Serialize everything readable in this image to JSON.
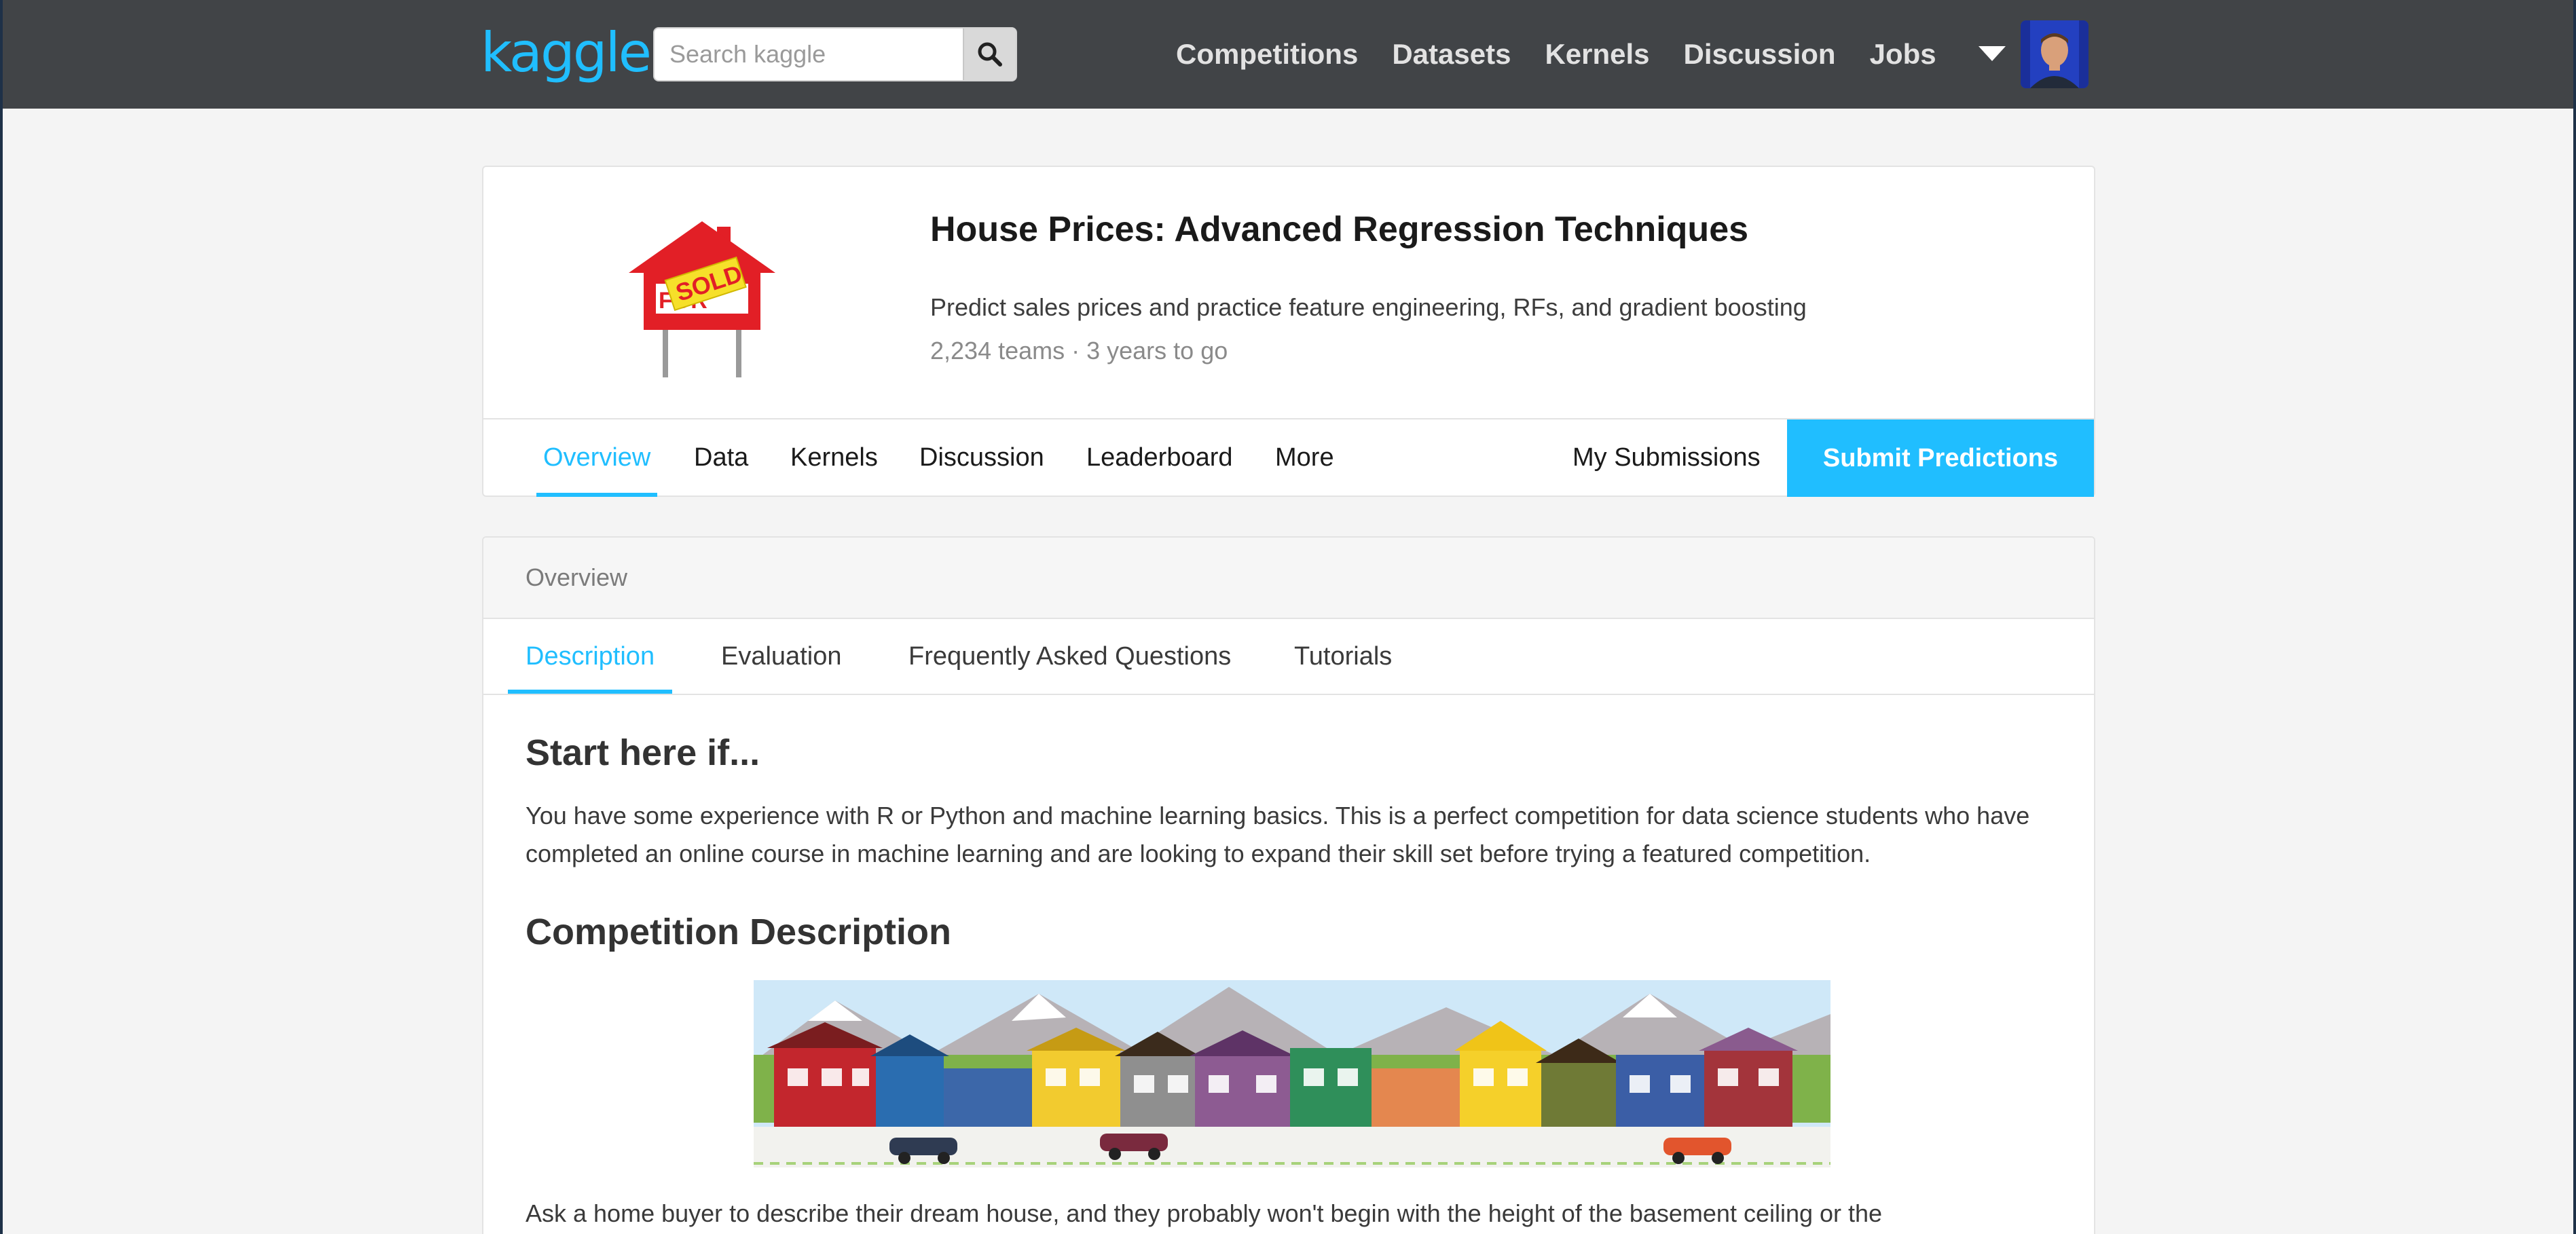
{
  "topbar": {
    "logo": "kaggle",
    "search": {
      "placeholder": "Search kaggle",
      "value": ""
    },
    "nav": [
      "Competitions",
      "Datasets",
      "Kernels",
      "Discussion",
      "Jobs"
    ]
  },
  "competition": {
    "title": "House Prices: Advanced Regression Techniques",
    "subtitle": "Predict sales prices and practice feature engineering, RFs, and gradient boosting",
    "meta": "2,234 teams · 3 years to go",
    "logo_sign_text": "SOLD",
    "logo_sign_under_text": "FOR SALE",
    "tabs": [
      "Overview",
      "Data",
      "Kernels",
      "Discussion",
      "Leaderboard",
      "More"
    ],
    "active_tab": "Overview",
    "my_submissions": "My Submissions",
    "submit_label": "Submit Predictions"
  },
  "overview": {
    "header": "Overview",
    "subtabs": [
      "Description",
      "Evaluation",
      "Frequently Asked Questions",
      "Tutorials"
    ],
    "active_subtab": "Description",
    "heading1": "Start here if...",
    "paragraph1": "You have some experience with R or Python and machine learning basics. This is a perfect competition for data science students who have completed an online course in machine learning and are looking to expand their skill set before trying a featured competition.",
    "heading2": "Competition Description",
    "paragraph2": "Ask a home buyer to describe their dream house, and they probably won't begin with the height of the basement ceiling or the"
  },
  "colors": {
    "accent": "#20beff",
    "topbar": "#414447",
    "page_bg": "#f4f4f4"
  }
}
